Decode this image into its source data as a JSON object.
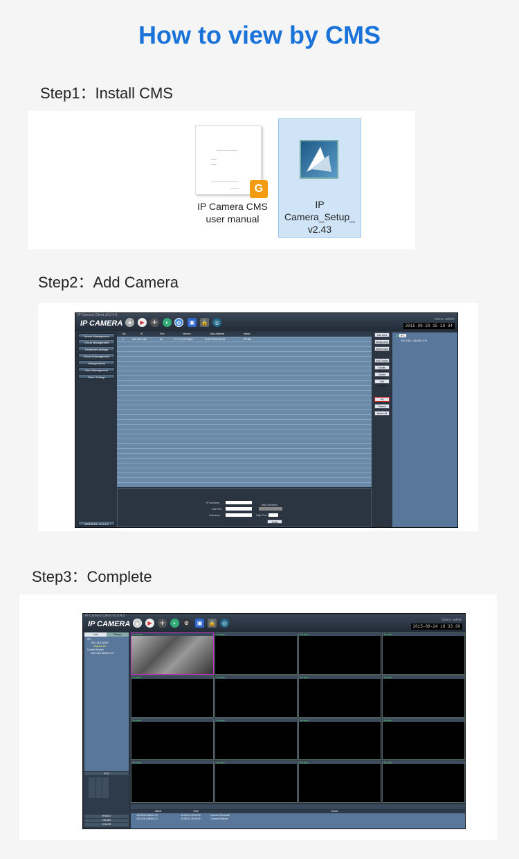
{
  "title": "How to view by CMS",
  "steps": {
    "s1": "Step1：Install CMS",
    "s2": "Step2：Add Camera",
    "s3": "Step3：Complete"
  },
  "files": {
    "manual_line1": "IP Camera CMS",
    "manual_line2": "user manual",
    "setup_line1": "IP",
    "setup_line2": "Camera_Setup_",
    "setup_line3": "v2.43"
  },
  "cms": {
    "window_title": "IP Camera Client v2.0.4.3",
    "app_name": "IP CAMERA",
    "users": "Users: admin",
    "clock2": "2015-09-29 15 26 34",
    "clock3": "2015-09-24 19 33 30",
    "menu": [
      "Device Management",
      "Group Management",
      "Parameter settings",
      "Record Management",
      "Linkage Alarm",
      "User Management",
      "Other Settings"
    ],
    "version": "VERSION: v2.0.4.3",
    "table_headers": [
      "No.",
      "IP",
      "Port",
      "Version",
      "Mac Address",
      "Name"
    ],
    "table_row": [
      "1",
      "192.168.1.88",
      "80",
      "V7.1.4.1.f013f6c6",
      "00:E0:F8:03:2D:20",
      "IPCAM"
    ],
    "side_buttons": [
      "Add Area",
      "Modify Area",
      "Delete Area",
      "Add Device",
      "Modify Device",
      "Delete Device",
      "Edit Channel",
      "Fill",
      "Search",
      "Select All"
    ],
    "tree_item": "IPC",
    "tree_sub": "192.168.1.88:80-CH1",
    "net_labels": [
      "IP Address",
      "Sub Net",
      "Gateway"
    ],
    "mac_label": "Mac Address",
    "http_label": "Http Port",
    "apply": "Apply",
    "tabs": [
      "List",
      "Group"
    ],
    "tree3": [
      "IPC",
      "192.168.1.88:80",
      "Channel 01",
      "Current Screen",
      "192.168.1.88:80-CH1"
    ],
    "ptz": "PTZ",
    "preset": "PRESET",
    "cruise": "CRUISE",
    "color": "COLOR",
    "cell_label": "No Video",
    "cell_label_first": "IP Camera",
    "log_headers": [
      "Name",
      "Time",
      "Event"
    ],
    "log_rows": [
      [
        "192.168.1.88:80-C1",
        "15-09-24 19:33:30",
        "Connect Success!"
      ],
      [
        "192.168.1.88:80-C1",
        "15-09-24 19:33:26",
        "Connect Failure!"
      ]
    ]
  }
}
